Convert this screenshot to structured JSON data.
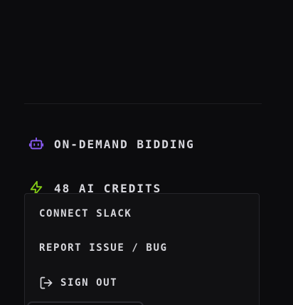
{
  "menu": {
    "bidding_label": "ON-DEMAND BIDDING",
    "bidding_icon": "robot-icon",
    "credits_label": "48 AI CREDITS",
    "credits_icon": "lightning-bolt-icon"
  },
  "dropdown": {
    "connect_slack_label": "CONNECT SLACK",
    "report_issue_label": "REPORT ISSUE / BUG",
    "sign_out_label": "SIGN OUT",
    "sign_out_icon": "sign-out-icon"
  },
  "colors": {
    "background": "#0c0c0e",
    "accent_purple": "#8b5cf6",
    "accent_green": "#84cc16",
    "text": "#d9d9df"
  }
}
